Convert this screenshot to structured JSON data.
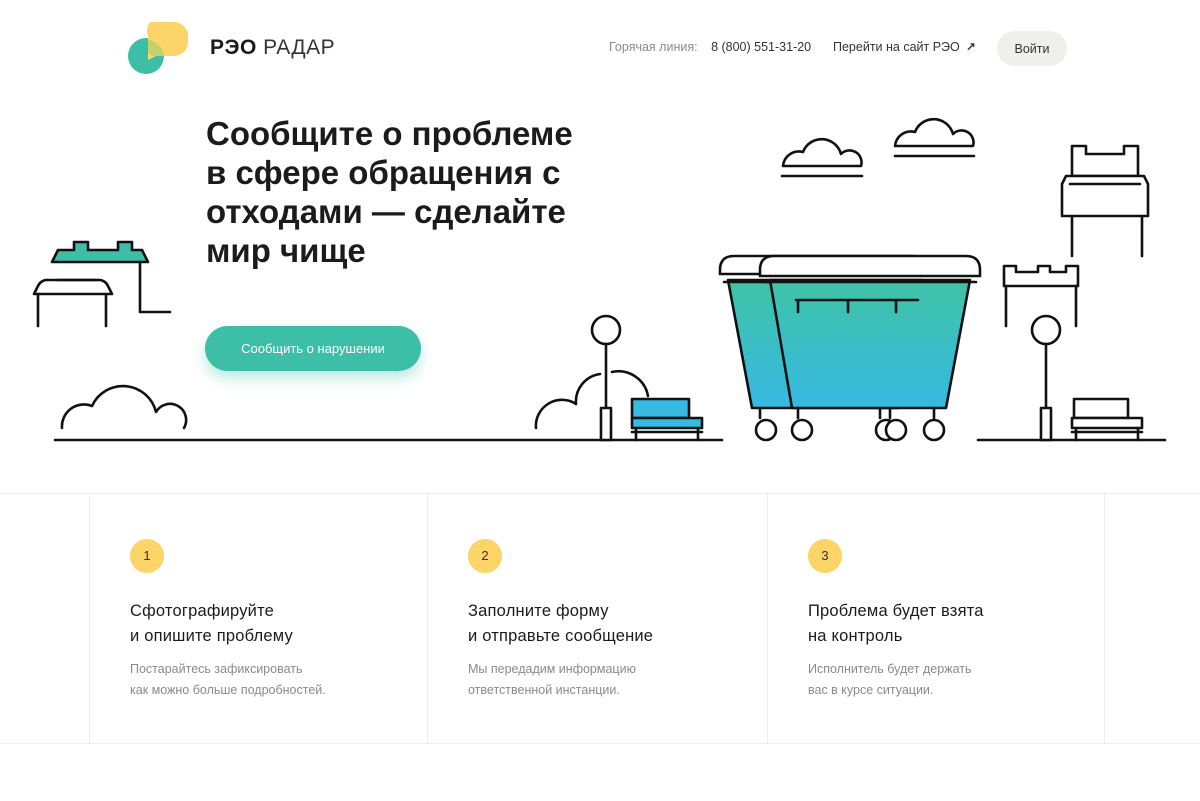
{
  "header": {
    "logo_bold": "РЭО",
    "logo_light": "РАДАР",
    "hotline_label": "Горячая линия:",
    "hotline_phone": "8 (800) 551-31-20",
    "external_link": "Перейти на сайт РЭО",
    "login_label": "Войти"
  },
  "hero": {
    "title": "Сообщите о проблеме\n в сфере обращения с\nотходами — сделайте\nмир чище",
    "cta_label": "Сообщить о нарушении"
  },
  "steps": [
    {
      "number": "1",
      "title": "Сфотографируйте\nи опишите проблему",
      "description": "Постарайтесь зафиксировать\nкак можно больше подробностей."
    },
    {
      "number": "2",
      "title": "Заполните форму\nи отправьте сообщение",
      "description": "Мы передадим информацию\nответственной инстанции."
    },
    {
      "number": "3",
      "title": "Проблема будет взята\nна контроль",
      "description": "Исполнитель будет держать\nвас в курсе ситуации."
    }
  ],
  "colors": {
    "accent_teal": "#3dbfa7",
    "accent_yellow": "#fdd467",
    "container_gradient_top": "#3fc3a6",
    "container_gradient_bottom": "#36b9e2",
    "button_gray": "#efefed"
  }
}
